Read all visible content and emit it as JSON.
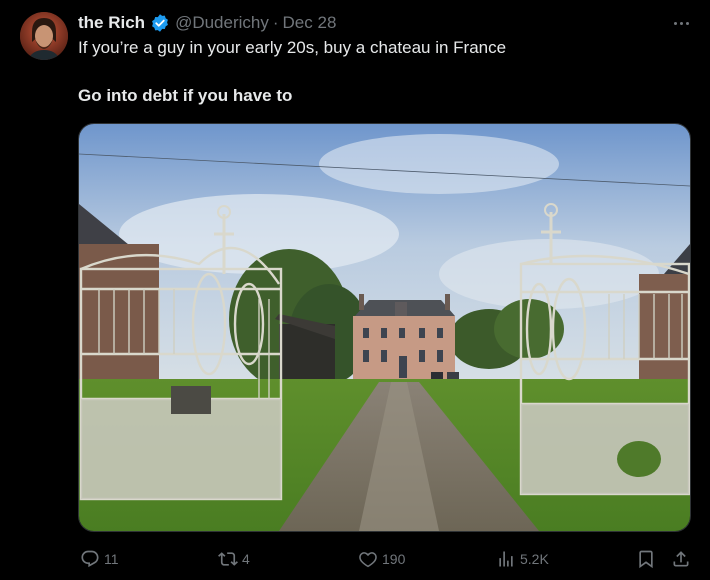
{
  "tweet": {
    "author_name": "the Rich",
    "author_handle": "@Duderichy",
    "separator": "·",
    "date": "Dec 28",
    "text_line1": "If you’re a guy in your early 20s, buy a chateau in France",
    "text_line2": "Go into debt if you have to"
  },
  "actions": {
    "replies": "11",
    "reposts": "4",
    "likes": "190",
    "views": "5.2K"
  },
  "colors": {
    "background": "#000000",
    "text": "#e7e9ea",
    "muted": "#71767b",
    "verified": "#1d9bf0"
  },
  "icons": [
    "verified-badge-icon",
    "more-icon",
    "reply-icon",
    "repost-icon",
    "like-icon",
    "views-icon",
    "bookmark-icon",
    "share-icon"
  ]
}
